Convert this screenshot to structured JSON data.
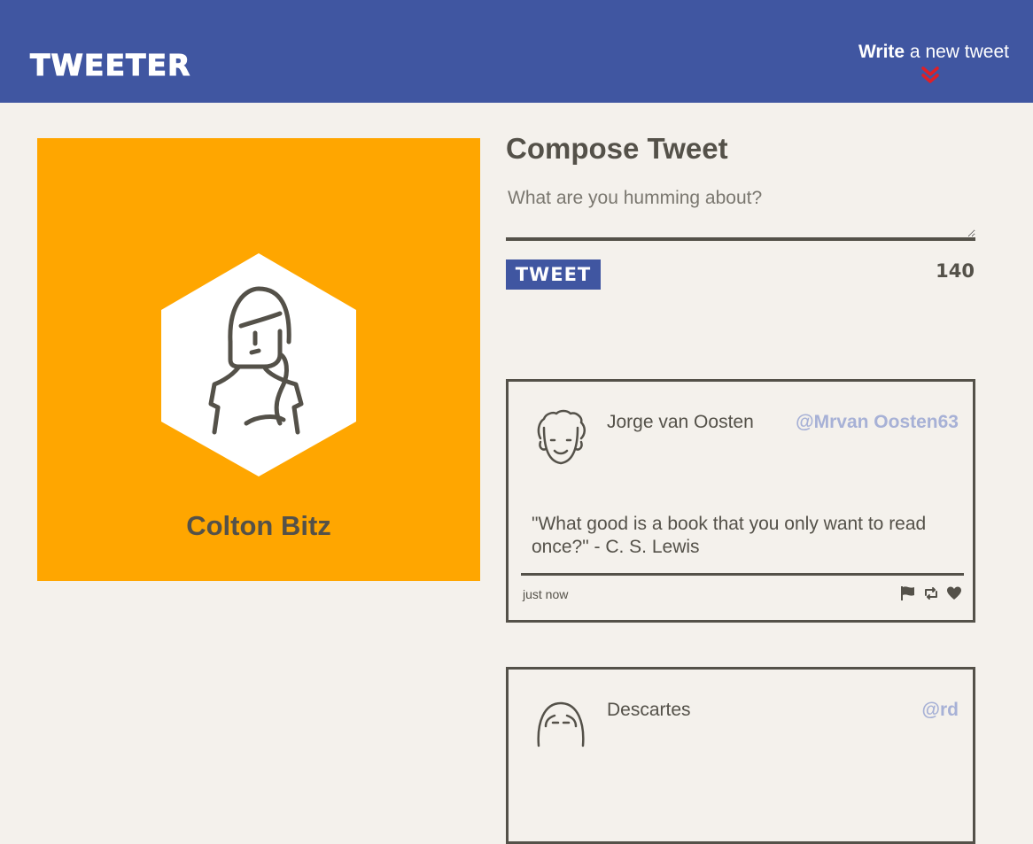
{
  "nav": {
    "brand": "TWEETER",
    "write_bold": "Write",
    "write_rest": " a new tweet",
    "accent_color": "#4056a1",
    "chevron_color": "#e01f26"
  },
  "profile": {
    "name": "Colton Bitz",
    "background_color": "#ffa600"
  },
  "compose": {
    "title": "Compose Tweet",
    "placeholder": "What are you humming about?",
    "button_label": "TWEET",
    "counter": "140"
  },
  "tweets": [
    {
      "author": "Jorge van Oosten",
      "handle": "@Mrvan Oosten63",
      "content": "\"What good is a book that you only want to read once?\" - C. S. Lewis",
      "time": "just now",
      "actions": [
        "flag-icon",
        "retweet-icon",
        "heart-icon"
      ]
    },
    {
      "author": "Descartes",
      "handle": "@rd"
    }
  ]
}
